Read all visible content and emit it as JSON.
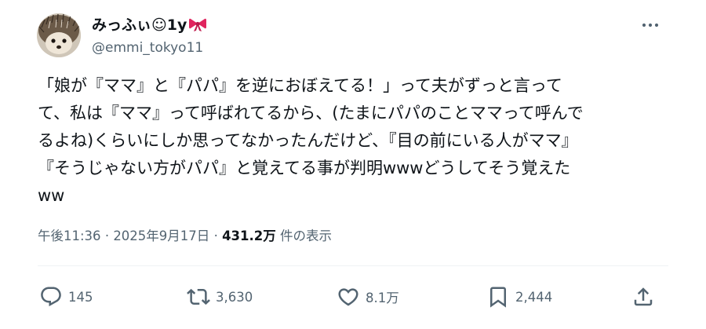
{
  "author": {
    "display_name": "みっふぃ☺1y",
    "handle": "@emmi_tokyo11",
    "avatar_icon": "hedgehog-avatar",
    "badge_icon": "red-ribbon-icon"
  },
  "tweet": {
    "text": "「娘が『ママ』と『パパ』を逆におぼえてる！」って夫がずっと言って\nて、私は『ママ』って呼ばれてるから、(たまにパパのことママって呼んで\nるよね)くらいにしか思ってなかったんだけど、『目の前にいる人がママ』\n『そうじゃない方がパパ』と覚えてる事が判明wwwどうしてそう覚えた\nww",
    "time": "午後11:36",
    "separator": "·",
    "date": "2025年9月17日",
    "views": "431.2万",
    "views_label": "件の表示"
  },
  "actions": {
    "replies": "145",
    "reposts": "3,630",
    "likes": "8.1万",
    "bookmarks": "2,444"
  },
  "colors": {
    "text": "#0f1419",
    "muted": "#536471",
    "divider": "#eff3f4",
    "ribbon": "#e0245e"
  }
}
